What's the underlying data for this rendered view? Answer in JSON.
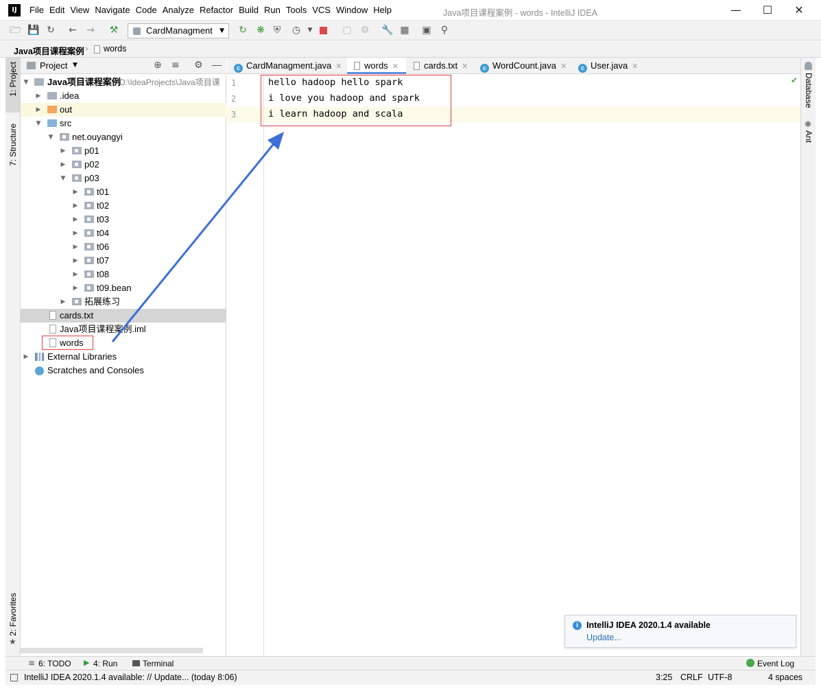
{
  "window": {
    "title": "Java项目课程案例 - words - IntelliJ IDEA",
    "app_icon": "IJ"
  },
  "menu": [
    "File",
    "Edit",
    "View",
    "Navigate",
    "Code",
    "Analyze",
    "Refactor",
    "Build",
    "Run",
    "Tools",
    "VCS",
    "Window",
    "Help"
  ],
  "toolbar": {
    "run_config": "CardManagment"
  },
  "breadcrumb": {
    "project": "Java项目课程案例",
    "file": "words"
  },
  "left_stripe": {
    "project_tab": "1: Project",
    "structure_tab": "7: Structure",
    "favorites_tab": "2: Favorites"
  },
  "project_panel": {
    "header": "Project",
    "root_label": "Java项目课程案例",
    "root_path": "D:\\IdeaProjects\\Java项目课",
    "tree": [
      {
        "label": ".idea"
      },
      {
        "label": "out"
      },
      {
        "label": "src"
      },
      {
        "label": "net.ouyangyi"
      },
      {
        "label": "p01"
      },
      {
        "label": "p02"
      },
      {
        "label": "p03"
      },
      {
        "label": "t01"
      },
      {
        "label": "t02"
      },
      {
        "label": "t03"
      },
      {
        "label": "t04"
      },
      {
        "label": "t06"
      },
      {
        "label": "t07"
      },
      {
        "label": "t08"
      },
      {
        "label": "t09.bean"
      },
      {
        "label": "拓展练习"
      },
      {
        "label": "cards.txt"
      },
      {
        "label": "Java项目课程案例.iml"
      },
      {
        "label": "words"
      },
      {
        "label": "External Libraries"
      },
      {
        "label": "Scratches and Consoles"
      }
    ]
  },
  "tabs": [
    {
      "label": "CardManagment.java"
    },
    {
      "label": "words"
    },
    {
      "label": "cards.txt"
    },
    {
      "label": "WordCount.java"
    },
    {
      "label": "User.java"
    }
  ],
  "editor": {
    "line_numbers": [
      "1",
      "2",
      "3"
    ],
    "lines": [
      "hello hadoop hello spark",
      "i love you hadoop and spark",
      "i learn hadoop and scala"
    ]
  },
  "right_stripe": {
    "database": "Database",
    "ant": "Ant"
  },
  "bottom_tools": {
    "todo": "6: TODO",
    "run": "4: Run",
    "terminal": "Terminal",
    "event_log": "Event Log"
  },
  "status": {
    "message": "IntelliJ IDEA 2020.1.4 available: // Update... (today 8:06)",
    "position": "3:25",
    "line_sep": "CRLF",
    "encoding": "UTF-8",
    "indent": "4 spaces"
  },
  "notification": {
    "title": "IntelliJ IDEA 2020.1.4 available",
    "link": "Update..."
  },
  "colors": {
    "accent": "#3d6fd6",
    "annotation_red": "#e04040",
    "panel_bg": "#f2f2f2",
    "selection": "#d5d5d5"
  }
}
